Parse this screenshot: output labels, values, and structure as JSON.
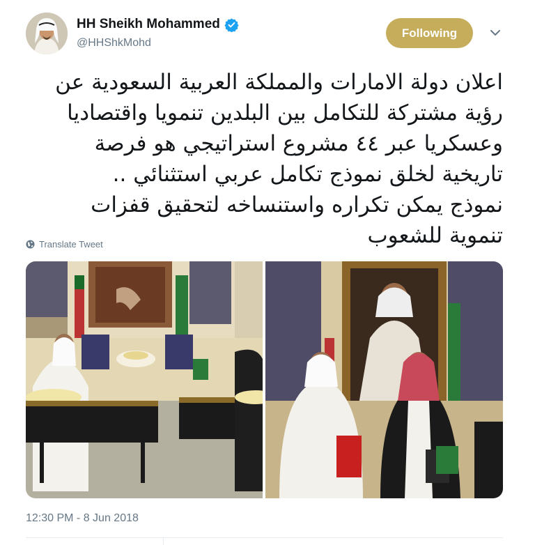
{
  "tweet": {
    "display_name": "HH Sheikh Mohammed",
    "handle": "@HHShkMohd",
    "follow_label": "Following",
    "text_lines": [
      "اعلان دولة الامارات والمملكة العربية السعودية عن",
      "رؤية مشتركة للتكامل بين البلدين تنمويا واقتصاديا",
      "وعسكريا عبر ٤٤ مشروع استراتيجي هو فرصة",
      "تاريخية لخلق نموذج تكامل عربي استثنائي ..",
      "نموذج يمكن تكراره واستنساخه لتحقيق قفزات",
      "تنموية للشعوب"
    ],
    "translate_label": "Translate Tweet",
    "timestamp": "12:30 PM - 8 Jun 2018"
  },
  "colors": {
    "follow_button": "#c6ad5c",
    "verified_badge": "#1da1f2",
    "muted_text": "#657786"
  },
  "icons": {
    "verified": "verified-badge-icon",
    "more": "chevron-down-icon",
    "translate": "globe-icon"
  }
}
